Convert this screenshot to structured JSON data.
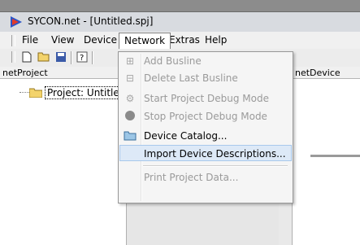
{
  "window": {
    "title": "SYCON.net - [Untitled.spj]"
  },
  "menubar": {
    "items": [
      {
        "label": "File"
      },
      {
        "label": "View"
      },
      {
        "label": "Device"
      },
      {
        "label": "Network"
      },
      {
        "label": "Extras"
      },
      {
        "label": "Help"
      }
    ],
    "open_menu": "Network"
  },
  "toolbar": {
    "buttons": [
      "new-icon",
      "open-folder-icon",
      "save-icon",
      "help-icon"
    ]
  },
  "left_pane": {
    "header": "netProject",
    "tree": {
      "root_label": "Project: Untitled"
    }
  },
  "right_pane": {
    "header": "netDevice"
  },
  "network_menu": {
    "items": [
      {
        "label": "Add Busline",
        "enabled": false,
        "icon": "add-busline-icon"
      },
      {
        "label": "Delete Last Busline",
        "enabled": false,
        "icon": "delete-busline-icon"
      },
      {
        "label": "Start Project Debug Mode",
        "enabled": false,
        "icon": "debug-start-icon"
      },
      {
        "label": "Stop Project Debug Mode",
        "enabled": false,
        "icon": "debug-stop-icon"
      },
      {
        "label": "Device Catalog...",
        "enabled": true,
        "icon": "device-catalog-icon"
      },
      {
        "label": "Import Device Descriptions...",
        "enabled": true,
        "highlighted": true
      },
      {
        "label": "Print Project Data...",
        "enabled": false
      }
    ]
  },
  "colors": {
    "highlight_bg": "#dde9f7",
    "highlight_border": "#a8c8ec",
    "disabled_text": "#9a9a9a"
  }
}
